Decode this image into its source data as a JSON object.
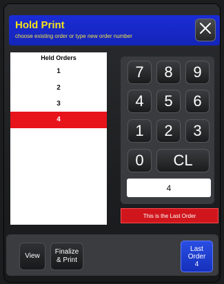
{
  "header": {
    "title": "Hold Print",
    "subtitle": "choose existing order or type new order number",
    "close_icon": "close-icon"
  },
  "held_orders": {
    "header": "Held Orders",
    "rows": [
      "1",
      "2",
      "3",
      "4"
    ],
    "selected": "4"
  },
  "keypad": {
    "keys": [
      "7",
      "8",
      "9",
      "4",
      "5",
      "6",
      "1",
      "2",
      "3",
      "0",
      "CL"
    ],
    "display_value": "4"
  },
  "message": "This is the Last Order",
  "bottom": {
    "view_label": "View",
    "finalize_line1": "Finalize",
    "finalize_line2": "& Print",
    "last_line1": "Last",
    "last_line2": "Order",
    "last_line3": "4"
  },
  "colors": {
    "title_bar": "#1b2cd6",
    "title_text": "#f5e21b",
    "selected_row": "#e8141c",
    "message_bg": "#d0161c",
    "last_order_button": "#2a4ee3"
  }
}
